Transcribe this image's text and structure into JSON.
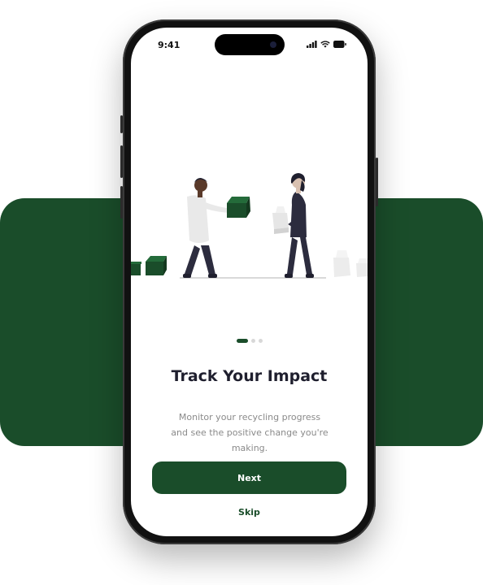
{
  "status_bar": {
    "time": "9:41",
    "icons": [
      "signal-icon",
      "wifi-icon",
      "battery-icon"
    ]
  },
  "onboarding": {
    "illustration": "people-exchanging-recyclables",
    "pagination": {
      "current": 1,
      "total": 3
    },
    "title": "Track Your Impact",
    "description": "Monitor your recycling progress and see the positive change you're making.",
    "next_label": "Next",
    "skip_label": "Skip"
  },
  "colors": {
    "accent": "#1a4d2a",
    "title": "#1f1f2e",
    "body_text": "#8a8a8a",
    "dot_inactive": "#d8d8d8"
  }
}
